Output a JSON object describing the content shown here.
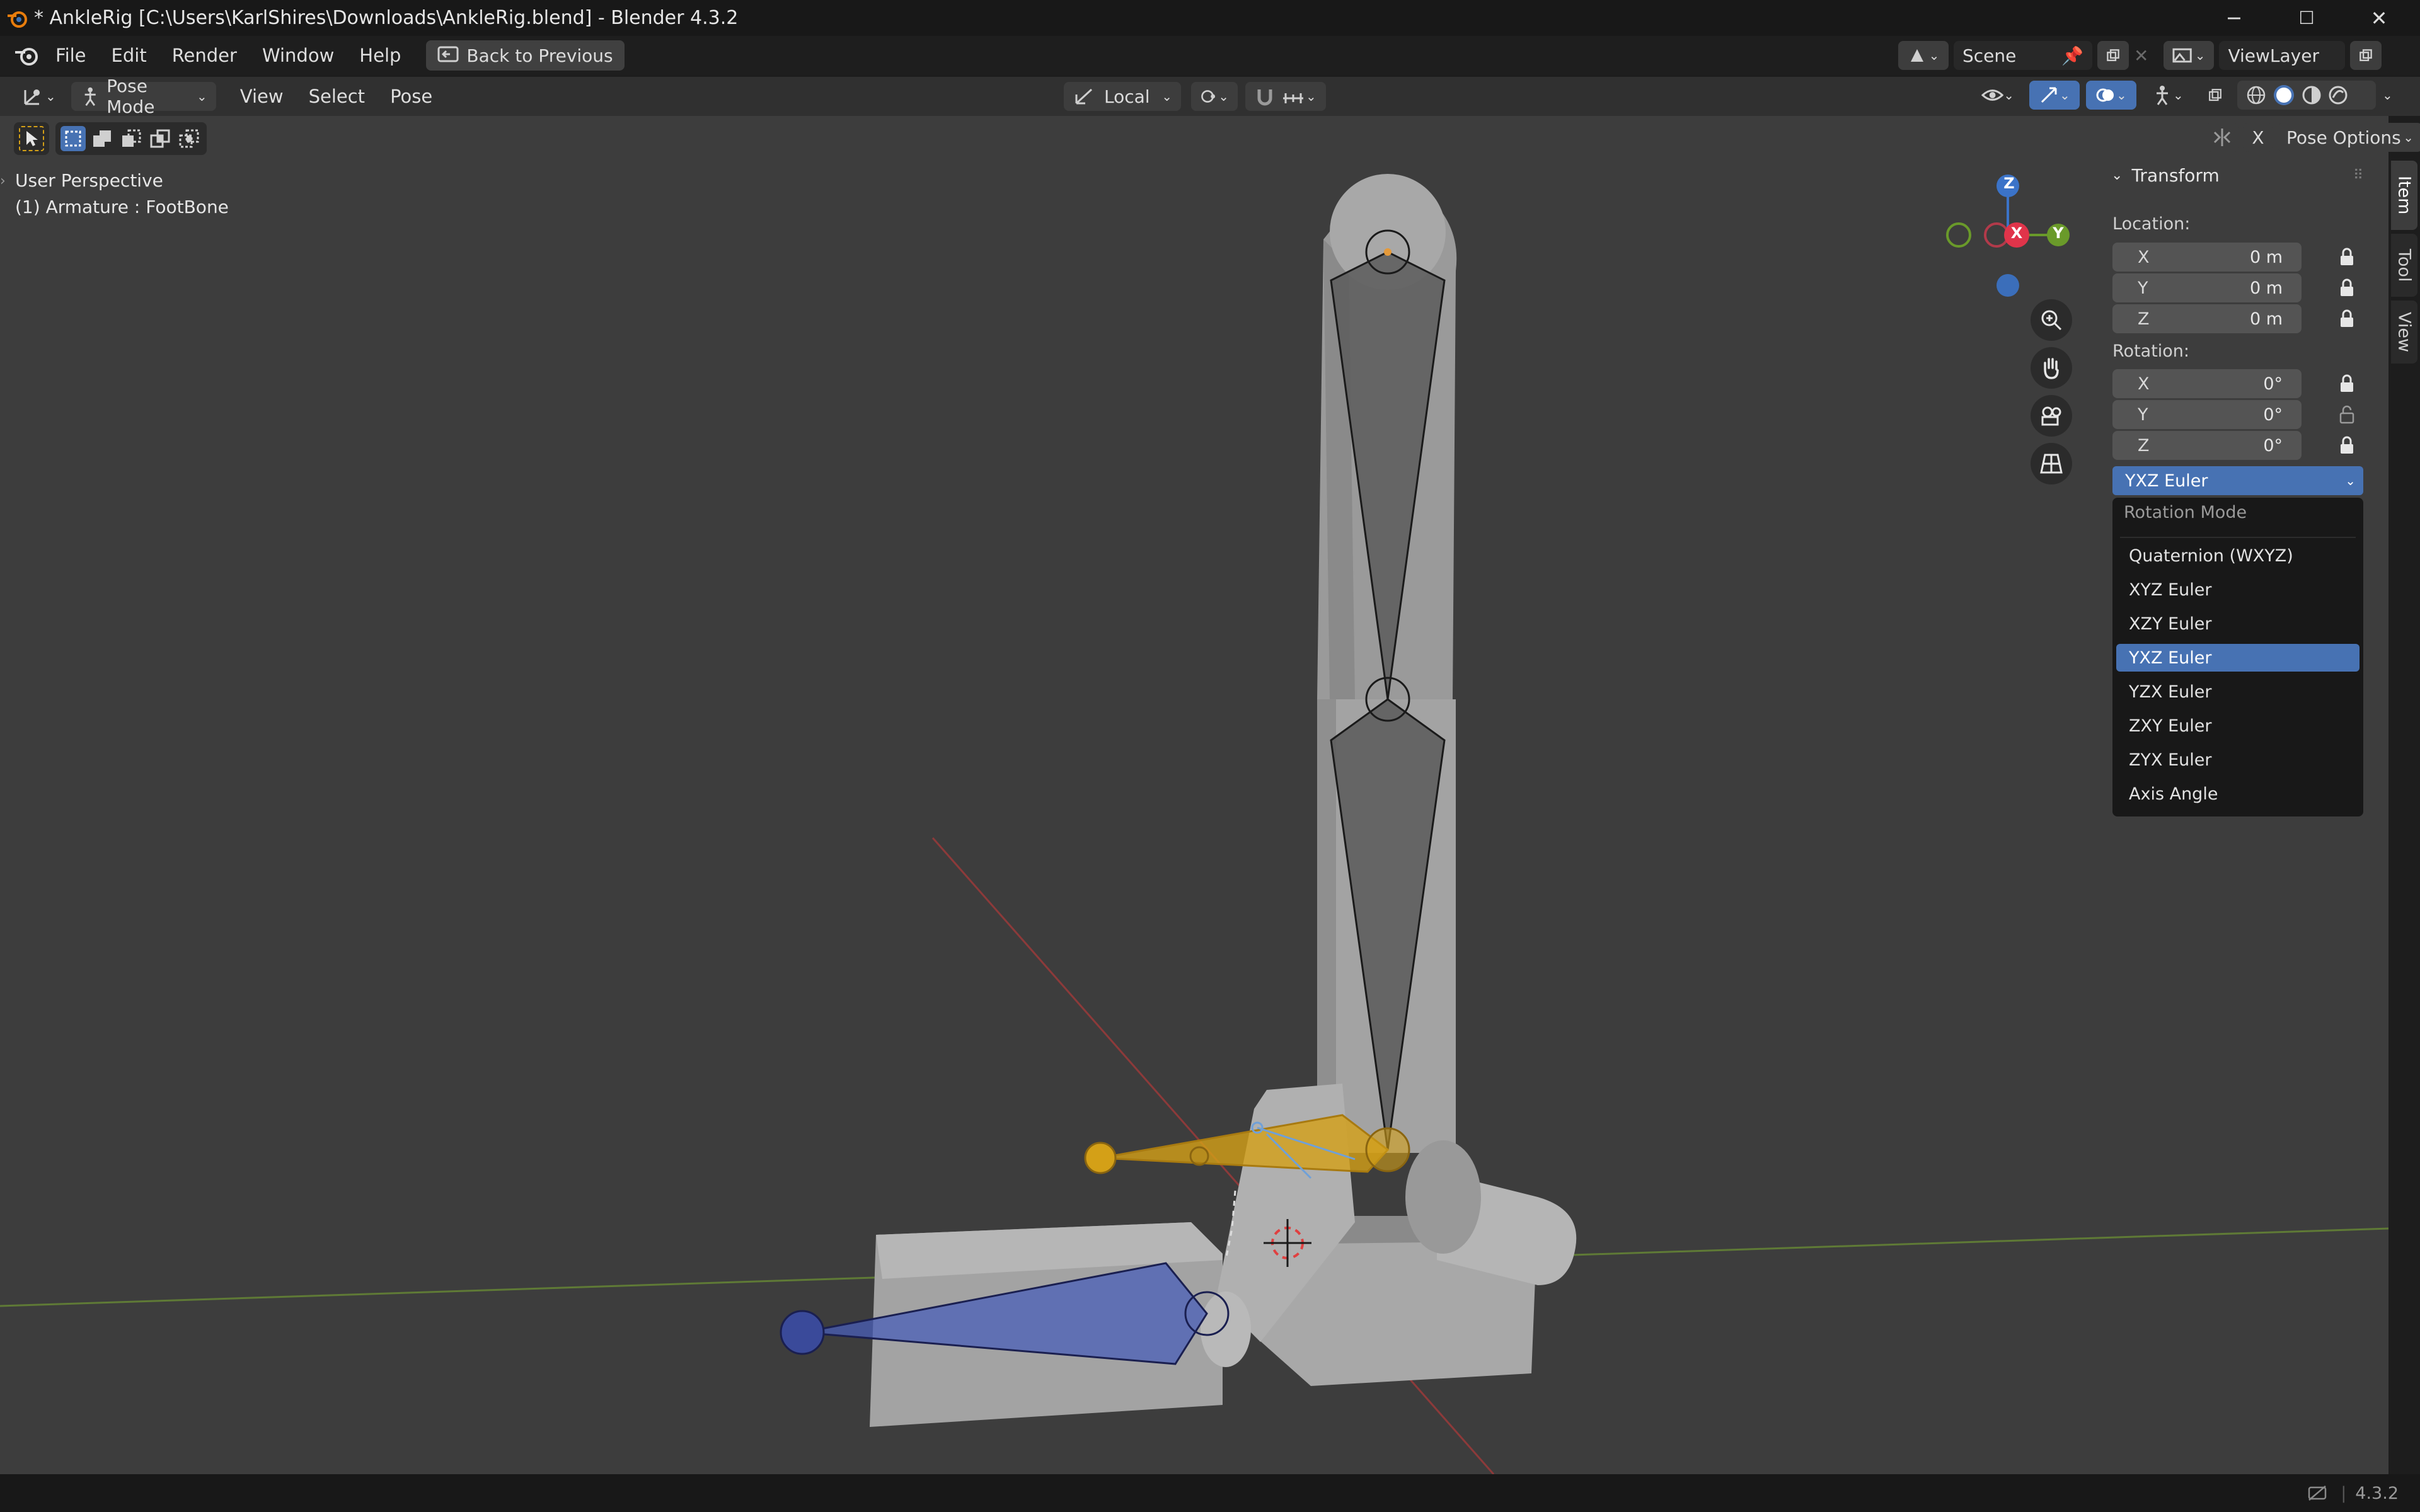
{
  "window": {
    "title": "* AnkleRig [C:\\Users\\KarlShires\\Downloads\\AnkleRig.blend] - Blender 4.3.2",
    "controls": {
      "minimize": "─",
      "maximize": "☐",
      "close": "✕"
    }
  },
  "menubar": {
    "items": [
      "File",
      "Edit",
      "Render",
      "Window",
      "Help"
    ],
    "back_button": "Back to Previous",
    "scene_name": "Scene",
    "view_layer": "ViewLayer"
  },
  "viewport_header": {
    "mode": "Pose Mode",
    "menus": [
      "View",
      "Select",
      "Pose"
    ],
    "orientation": "Local",
    "mirror_axis": "X",
    "pose_options": "Pose Options"
  },
  "viewport": {
    "perspective_label": "User Perspective",
    "object_label": "(1) Armature : FootBone",
    "gizmo": {
      "z": "Z",
      "x": "X",
      "y": "Y"
    }
  },
  "sidebar": {
    "panel_title": "Transform",
    "location_label": "Location:",
    "location": [
      {
        "axis": "X",
        "value": "0 m"
      },
      {
        "axis": "Y",
        "value": "0 m"
      },
      {
        "axis": "Z",
        "value": "0 m"
      }
    ],
    "rotation_label": "Rotation:",
    "rotation": [
      {
        "axis": "X",
        "value": "0°"
      },
      {
        "axis": "Y",
        "value": "0°"
      },
      {
        "axis": "Z",
        "value": "0°"
      }
    ],
    "rotation_mode_selected": "YXZ Euler",
    "dropdown": {
      "title": "Rotation Mode",
      "options": [
        "Quaternion (WXYZ)",
        "XYZ Euler",
        "XZY Euler",
        "YXZ Euler",
        "YZX Euler",
        "ZXY Euler",
        "ZYX Euler",
        "Axis Angle"
      ],
      "active_index": 3
    }
  },
  "tabs": [
    "Item",
    "Tool",
    "View"
  ],
  "statusbar": {
    "version": "4.3.2"
  },
  "colors": {
    "accent": "#4772b3",
    "selected_bone": "#d4a017",
    "bone_blue": "#4a5fb8"
  }
}
